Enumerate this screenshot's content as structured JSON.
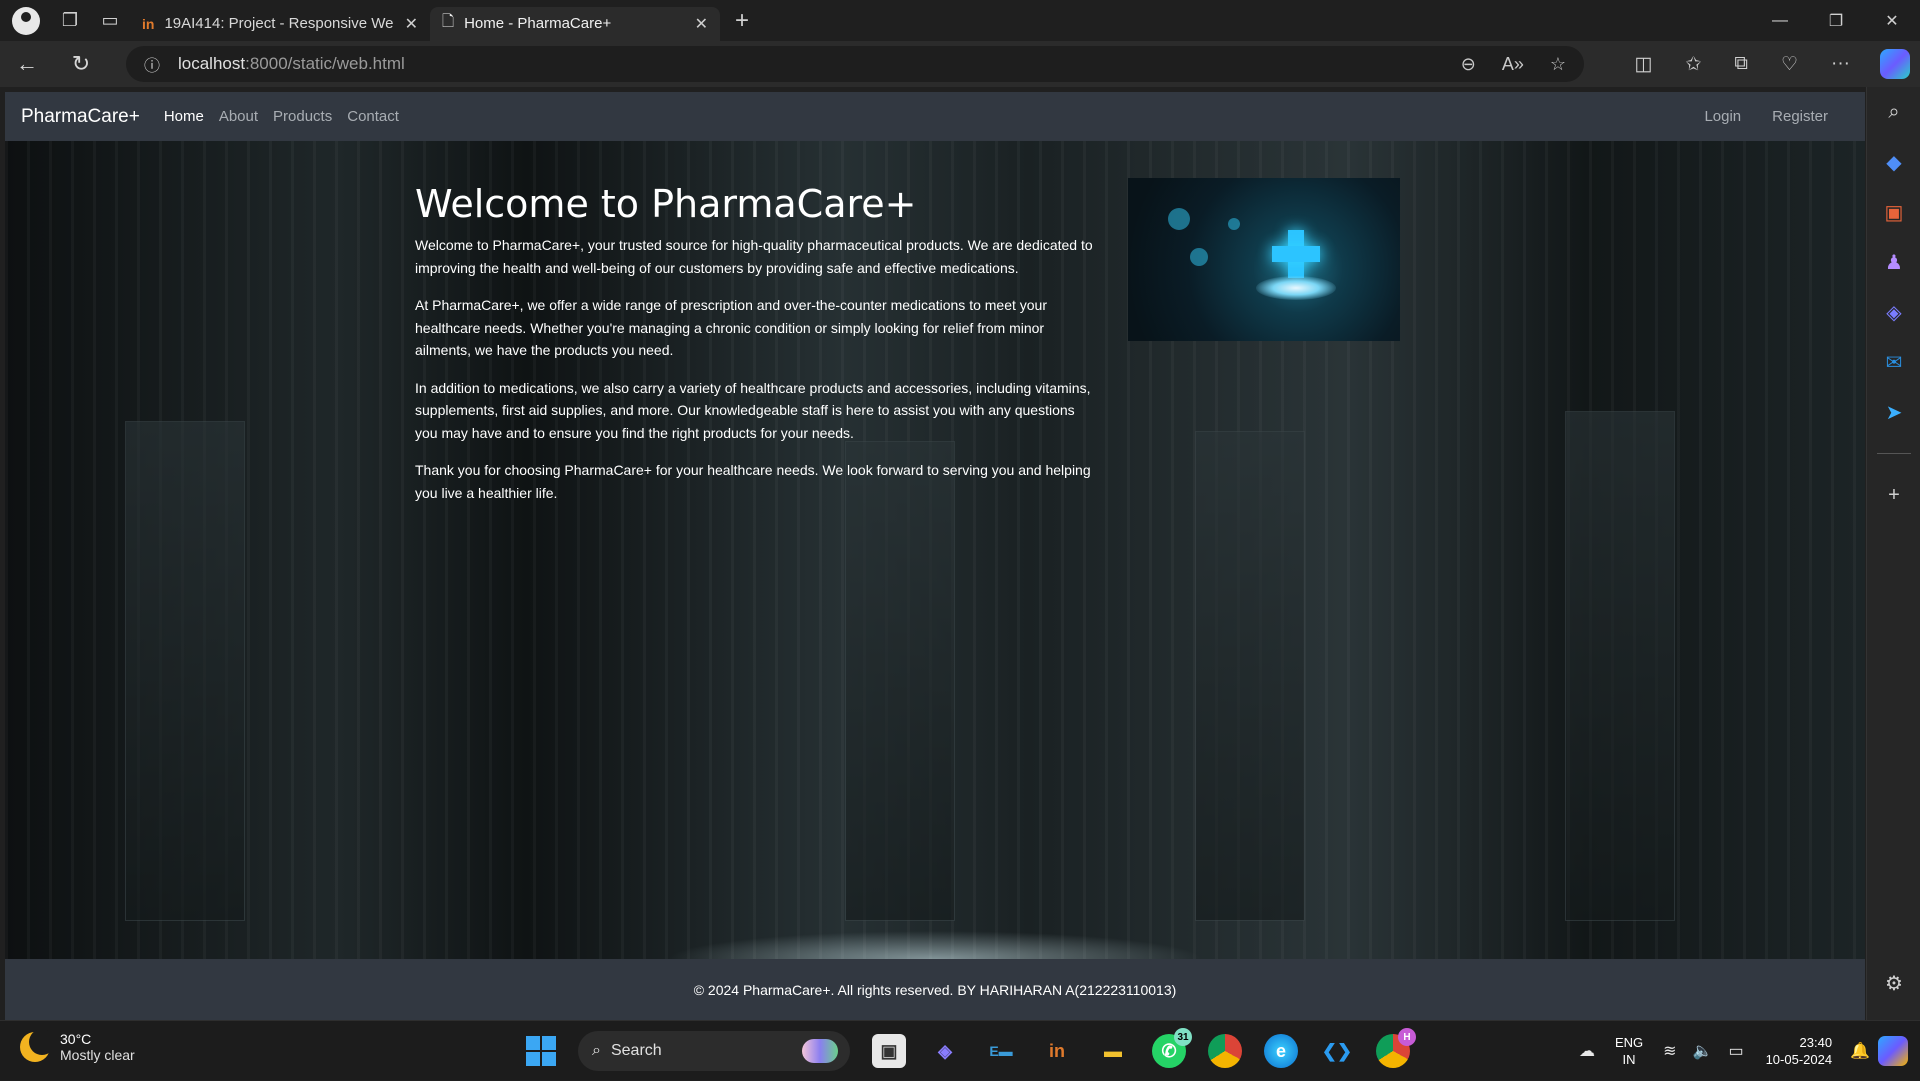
{
  "browser": {
    "tabs": [
      {
        "title": "19AI414: Project - Responsive We",
        "favicon": "moodle-in-icon",
        "active": false
      },
      {
        "title": "Home - PharmaCare+",
        "favicon": "page-icon",
        "active": true
      }
    ],
    "url_host": "localhost",
    "url_path": ":8000/static/web.html"
  },
  "site": {
    "brand": "PharmaCare+",
    "nav": [
      "Home",
      "About",
      "Products",
      "Contact"
    ],
    "auth": [
      "Login",
      "Register"
    ],
    "heading": "Welcome to PharmaCare+",
    "paragraphs": [
      "Welcome to PharmaCare+, your trusted source for high-quality pharmaceutical products. We are dedicated to improving the health and well-being of our customers by providing safe and effective medications.",
      "At PharmaCare+, we offer a wide range of prescription and over-the-counter medications to meet your healthcare needs. Whether you're managing a chronic condition or simply looking for relief from minor ailments, we have the products you need.",
      "In addition to medications, we also carry a variety of healthcare products and accessories, including vitamins, supplements, first aid supplies, and more. Our knowledgeable staff is here to assist you with any questions you may have and to ensure you find the right products for your needs.",
      "Thank you for choosing PharmaCare+ for your healthcare needs. We look forward to serving you and helping you live a healthier life."
    ],
    "footer": "© 2024 PharmaCare+. All rights reserved. BY HARIHARAN A(212223110013)"
  },
  "taskbar": {
    "temperature": "30°C",
    "condition": "Mostly clear",
    "search_label": "Search",
    "whatsapp_badge": "31",
    "chrome_badge": "H",
    "lang1": "ENG",
    "lang2": "IN",
    "time": "23:40",
    "date": "10-05-2024"
  },
  "colors": {
    "navbar": "#323841",
    "accent": "#2cc4ff"
  }
}
